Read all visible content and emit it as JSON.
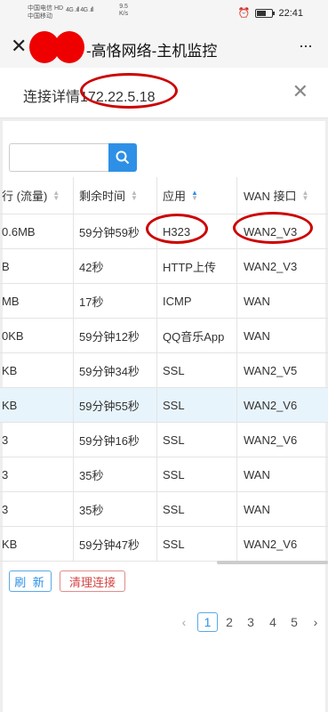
{
  "status_bar": {
    "carrier1": "中国电信",
    "carrier1_badge": "HD",
    "carrier2": "中国移动",
    "signal": "4G .ıll 4G .ıll",
    "speed_value": "9.5",
    "speed_unit": "K/s",
    "time": "22:41"
  },
  "header": {
    "title": "-高恪网络-主机监控",
    "more": "···"
  },
  "panel": {
    "label": "连接详情",
    "ip": "172.22.5.18"
  },
  "search": {
    "placeholder": ""
  },
  "table": {
    "headers": [
      "行 (流量)",
      "剩余时间",
      "应用",
      "WAN 接口"
    ],
    "rows": [
      [
        "0.6MB",
        "59分钟59秒",
        "H323",
        "WAN2_V3"
      ],
      [
        "B",
        "42秒",
        "HTTP上传",
        "WAN2_V3"
      ],
      [
        "MB",
        "17秒",
        "ICMP",
        "WAN"
      ],
      [
        "0KB",
        "59分钟12秒",
        "QQ音乐App",
        "WAN"
      ],
      [
        "KB",
        "59分钟34秒",
        "SSL",
        "WAN2_V5"
      ],
      [
        "KB",
        "59分钟55秒",
        "SSL",
        "WAN2_V6"
      ],
      [
        "3",
        "59分钟16秒",
        "SSL",
        "WAN2_V6"
      ],
      [
        "3",
        "35秒",
        "SSL",
        "WAN"
      ],
      [
        "3",
        "35秒",
        "SSL",
        "WAN"
      ],
      [
        "KB",
        "59分钟47秒",
        "SSL",
        "WAN2_V6"
      ]
    ],
    "highlighted_row": 5
  },
  "buttons": {
    "refresh": "刷 新",
    "clear": "清理连接"
  },
  "pagination": {
    "prev": "‹",
    "current": "1",
    "pages": [
      "2",
      "3",
      "4",
      "5"
    ],
    "next": "›"
  },
  "colors": {
    "accent": "#2d90e6",
    "annotation_red": "#cc0000"
  }
}
